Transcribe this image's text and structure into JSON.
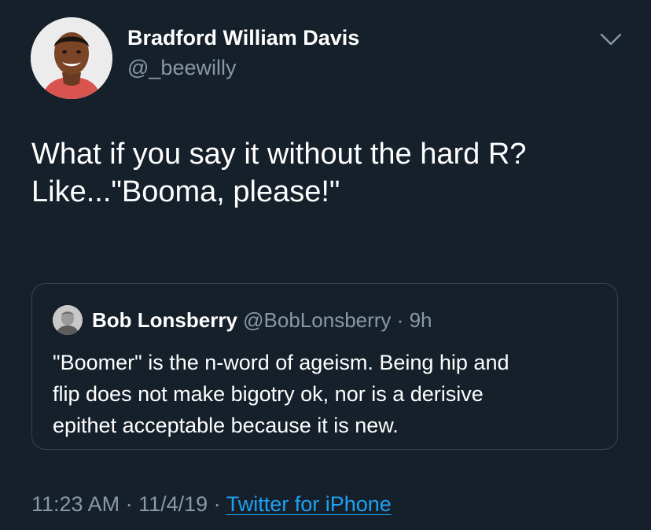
{
  "author": {
    "display_name": "Bradford William Davis",
    "handle": "@_beewilly"
  },
  "tweet": {
    "lines": [
      "What if you say it without the hard R?",
      "Like...\"Booma, please!\""
    ]
  },
  "quoted_tweet": {
    "display_name": "Bob Lonsberry",
    "handle": "@BobLonsberry",
    "separator": "·",
    "time": "9h",
    "lines": [
      "\"Boomer\" is the n-word of ageism. Being hip and",
      "flip does not make bigotry ok, nor is a derisive",
      "epithet acceptable because it is new."
    ]
  },
  "meta": {
    "time": "11:23 AM",
    "separator": " · ",
    "date": "11/4/19",
    "source": "Twitter for iPhone"
  },
  "icons": {
    "more": "chevron-down-icon",
    "avatar": "profile-photo",
    "quote_avatar": "profile-photo"
  },
  "colors": {
    "background": "#15202b",
    "primary_text": "#ffffff",
    "secondary_text": "#8899a6",
    "link": "#1da1f2",
    "border": "#38444d"
  }
}
